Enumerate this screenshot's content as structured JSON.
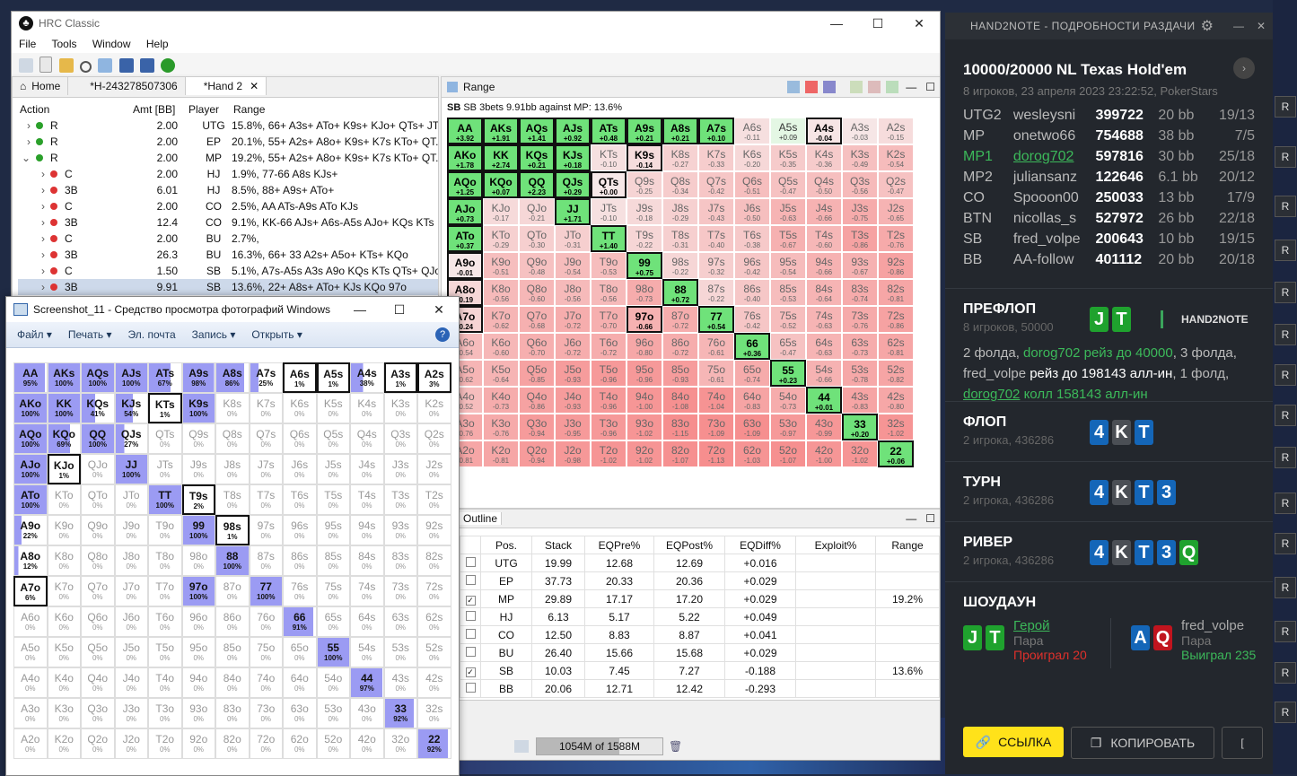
{
  "hrc": {
    "title": "HRC Classic",
    "menu": [
      "File",
      "Tools",
      "Window",
      "Help"
    ],
    "tabs": [
      {
        "label": "Home"
      },
      {
        "label": "*H-243278507306"
      },
      {
        "label": "*Hand 2"
      }
    ],
    "action_headers": [
      "Action",
      "Amt [BB]",
      "Player",
      "Range"
    ],
    "actions": [
      {
        "act": "R",
        "amt": "2.00",
        "player": "UTG",
        "range": "15.8%, 66+ A3s+ ATo+ K9s+ KJo+ QTs+ JTs",
        "color": "#2aa02a",
        "indent": 0
      },
      {
        "act": "R",
        "amt": "2.00",
        "player": "EP",
        "range": "20.1%, 55+ A2s+ A8o+ K9s+ K7s KTo+ QT...",
        "color": "#2aa02a",
        "indent": 0
      },
      {
        "act": "R",
        "amt": "2.00",
        "player": "MP",
        "range": "19.2%, 55+ A2s+ A8o+ K9s+ K7s KTo+ QT...",
        "color": "#2aa02a",
        "indent": 0
      },
      {
        "act": "C",
        "amt": "2.00",
        "player": "HJ",
        "range": "1.9%, 77-66 A8s KJs+",
        "color": "#d33",
        "indent": 1
      },
      {
        "act": "3B",
        "amt": "6.01",
        "player": "HJ",
        "range": "8.5%, 88+ A9s+ ATo+",
        "color": "#d33",
        "indent": 1
      },
      {
        "act": "C",
        "amt": "2.00",
        "player": "CO",
        "range": "2.5%, AA ATs-A9s ATo KJs",
        "color": "#d33",
        "indent": 1
      },
      {
        "act": "3B",
        "amt": "12.4",
        "player": "CO",
        "range": "9.1%, KK-66 AJs+ A6s-A5s AJo+ KQs KTs",
        "color": "#d33",
        "indent": 1
      },
      {
        "act": "C",
        "amt": "2.00",
        "player": "BU",
        "range": "2.7%,",
        "color": "#d33",
        "indent": 1
      },
      {
        "act": "3B",
        "amt": "26.3",
        "player": "BU",
        "range": "16.3%, 66+ 33 A2s+ A5o+ KTs+ KQo",
        "color": "#d33",
        "indent": 1
      },
      {
        "act": "C",
        "amt": "1.50",
        "player": "SB",
        "range": "5.1%, A7s-A5s A3s A9o KQs KTs QTs+ QJo...",
        "color": "#d33",
        "indent": 1
      },
      {
        "act": "3B",
        "amt": "9.91",
        "player": "SB",
        "range": "13.6%, 22+ A8s+ ATo+ KJs KQo 97o",
        "color": "#d33",
        "indent": 1
      }
    ],
    "range_tab": "Range",
    "range_title": "SB 3bets 9.91bb against MP: 13.6%",
    "outline_tab": "Outline",
    "outline_headers": [
      "Pos.",
      "Stack",
      "EQPre%",
      "EQPost%",
      "EQDiff%",
      "Exploit%",
      "Range"
    ],
    "outline_rows": [
      {
        "pos": "UTG",
        "stack": "19.99",
        "pre": "12.68",
        "post": "12.69",
        "diff": "+0.016",
        "exploit": "",
        "range": "",
        "checked": false
      },
      {
        "pos": "EP",
        "stack": "37.73",
        "pre": "20.33",
        "post": "20.36",
        "diff": "+0.029",
        "exploit": "",
        "range": "",
        "checked": false
      },
      {
        "pos": "MP",
        "stack": "29.89",
        "pre": "17.17",
        "post": "17.20",
        "diff": "+0.029",
        "exploit": "",
        "range": "19.2%",
        "checked": true
      },
      {
        "pos": "HJ",
        "stack": "6.13",
        "pre": "5.17",
        "post": "5.22",
        "diff": "+0.049",
        "exploit": "",
        "range": "",
        "checked": false
      },
      {
        "pos": "CO",
        "stack": "12.50",
        "pre": "8.83",
        "post": "8.87",
        "diff": "+0.041",
        "exploit": "",
        "range": "",
        "checked": false
      },
      {
        "pos": "BU",
        "stack": "26.40",
        "pre": "15.66",
        "post": "15.68",
        "diff": "+0.029",
        "exploit": "",
        "range": "",
        "checked": false
      },
      {
        "pos": "SB",
        "stack": "10.03",
        "pre": "7.45",
        "post": "7.27",
        "diff": "-0.188",
        "exploit": "",
        "range": "13.6%",
        "checked": true
      },
      {
        "pos": "BB",
        "stack": "20.06",
        "pre": "12.71",
        "post": "12.42",
        "diff": "-0.293",
        "exploit": "",
        "range": "",
        "checked": false
      }
    ],
    "memory": "1054M of 1588M",
    "memory_fraction": 0.66
  },
  "range_grid": {
    "hands": [
      [
        "AA",
        "AKs",
        "AQs",
        "AJs",
        "ATs",
        "A9s",
        "A8s",
        "A7s",
        "A6s",
        "A5s",
        "A4s",
        "A3s",
        "A2s"
      ],
      [
        "AKo",
        "KK",
        "KQs",
        "KJs",
        "KTs",
        "K9s",
        "K8s",
        "K7s",
        "K6s",
        "K5s",
        "K4s",
        "K3s",
        "K2s"
      ],
      [
        "AQo",
        "KQo",
        "QQ",
        "QJs",
        "QTs",
        "Q9s",
        "Q8s",
        "Q7s",
        "Q6s",
        "Q5s",
        "Q4s",
        "Q3s",
        "Q2s"
      ],
      [
        "AJo",
        "KJo",
        "QJo",
        "JJ",
        "JTs",
        "J9s",
        "J8s",
        "J7s",
        "J6s",
        "J5s",
        "J4s",
        "J3s",
        "J2s"
      ],
      [
        "ATo",
        "KTo",
        "QTo",
        "JTo",
        "TT",
        "T9s",
        "T8s",
        "T7s",
        "T6s",
        "T5s",
        "T4s",
        "T3s",
        "T2s"
      ],
      [
        "A9o",
        "K9o",
        "Q9o",
        "J9o",
        "T9o",
        "99",
        "98s",
        "97s",
        "96s",
        "95s",
        "94s",
        "93s",
        "92s"
      ],
      [
        "A8o",
        "K8o",
        "Q8o",
        "J8o",
        "T8o",
        "98o",
        "88",
        "87s",
        "86s",
        "85s",
        "84s",
        "83s",
        "82s"
      ],
      [
        "A7o",
        "K7o",
        "Q7o",
        "J7o",
        "T7o",
        "97o",
        "87o",
        "77",
        "76s",
        "75s",
        "74s",
        "73s",
        "72s"
      ],
      [
        "A6o",
        "K6o",
        "Q6o",
        "J6o",
        "T6o",
        "96o",
        "86o",
        "76o",
        "66",
        "65s",
        "64s",
        "63s",
        "62s"
      ],
      [
        "A5o",
        "K5o",
        "Q5o",
        "J5o",
        "T5o",
        "95o",
        "85o",
        "75o",
        "65o",
        "55",
        "54s",
        "53s",
        "52s"
      ],
      [
        "A4o",
        "K4o",
        "Q4o",
        "J4o",
        "T4o",
        "94o",
        "84o",
        "74o",
        "64o",
        "54o",
        "44",
        "43s",
        "42s"
      ],
      [
        "A3o",
        "K3o",
        "Q3o",
        "J3o",
        "T3o",
        "93o",
        "83o",
        "73o",
        "63o",
        "53o",
        "43o",
        "33",
        "32s"
      ],
      [
        "A2o",
        "K2o",
        "Q2o",
        "J2o",
        "T2o",
        "92o",
        "82o",
        "72o",
        "62o",
        "52o",
        "42o",
        "32o",
        "22"
      ]
    ],
    "values": [
      [
        "+3.92",
        "+1.91",
        "+1.41",
        "+0.92",
        "+0.48",
        "+0.21",
        "+0.21",
        "+0.10",
        "-0.11",
        "+0.09",
        "-0.04",
        "-0.03",
        "-0.15"
      ],
      [
        "+1.78",
        "+2.74",
        "+0.21",
        "+0.18",
        "-0.10",
        "-0.14",
        "-0.27",
        "-0.33",
        "-0.20",
        "-0.35",
        "-0.36",
        "-0.49",
        "-0.54"
      ],
      [
        "+1.25",
        "+0.07",
        "+2.23",
        "+0.29",
        "+0.00",
        "-0.25",
        "-0.34",
        "-0.42",
        "-0.51",
        "-0.47",
        "-0.50",
        "-0.56",
        "-0.47"
      ],
      [
        "+0.73",
        "-0.17",
        "-0.21",
        "+1.71",
        "-0.10",
        "-0.18",
        "-0.29",
        "-0.43",
        "-0.50",
        "-0.63",
        "-0.66",
        "-0.75",
        "-0.65"
      ],
      [
        "+0.37",
        "-0.29",
        "-0.30",
        "-0.31",
        "+1.40",
        "-0.22",
        "-0.31",
        "-0.40",
        "-0.38",
        "-0.67",
        "-0.60",
        "-0.86",
        "-0.76"
      ],
      [
        "-0.01",
        "-0.51",
        "-0.48",
        "-0.54",
        "-0.53",
        "+0.75",
        "-0.22",
        "-0.32",
        "-0.42",
        "-0.54",
        "-0.66",
        "-0.67",
        "-0.86"
      ],
      [
        "-0.19",
        "-0.56",
        "-0.60",
        "-0.56",
        "-0.56",
        "-0.73",
        "+0.72",
        "-0.22",
        "-0.40",
        "-0.53",
        "-0.64",
        "-0.74",
        "-0.81"
      ],
      [
        "-0.24",
        "-0.62",
        "-0.68",
        "-0.72",
        "-0.70",
        "-0.66",
        "-0.72",
        "+0.54",
        "-0.42",
        "-0.52",
        "-0.63",
        "-0.76",
        "-0.86"
      ],
      [
        "-0.54",
        "-0.60",
        "-0.70",
        "-0.72",
        "-0.72",
        "-0.80",
        "-0.72",
        "-0.61",
        "+0.36",
        "-0.47",
        "-0.63",
        "-0.73",
        "-0.81"
      ],
      [
        "-0.62",
        "-0.64",
        "-0.85",
        "-0.93",
        "-0.96",
        "-0.96",
        "-0.93",
        "-0.61",
        "-0.74",
        "+0.23",
        "-0.66",
        "-0.78",
        "-0.82"
      ],
      [
        "-0.52",
        "-0.73",
        "-0.86",
        "-0.93",
        "-0.96",
        "-1.00",
        "-1.08",
        "-1.04",
        "-0.83",
        "-0.73",
        "+0.01",
        "-0.83",
        "-0.80"
      ],
      [
        "-0.76",
        "-0.76",
        "-0.94",
        "-0.95",
        "-0.96",
        "-1.02",
        "-1.15",
        "-1.09",
        "-1.09",
        "-0.97",
        "-0.99",
        "+0.20",
        "-1.02"
      ],
      [
        "-0.81",
        "-0.81",
        "-0.94",
        "-0.98",
        "-1.02",
        "-1.02",
        "-1.07",
        "-1.13",
        "-1.03",
        "-1.07",
        "-1.00",
        "-1.02",
        "+0.06"
      ]
    ],
    "selected": [
      [
        1,
        1,
        1,
        1,
        1,
        1,
        1,
        1,
        0,
        0,
        1,
        0,
        0
      ],
      [
        1,
        1,
        1,
        1,
        0,
        1,
        0,
        0,
        0,
        0,
        0,
        0,
        0
      ],
      [
        1,
        1,
        1,
        1,
        1,
        0,
        0,
        0,
        0,
        0,
        0,
        0,
        0
      ],
      [
        1,
        0,
        0,
        1,
        0,
        0,
        0,
        0,
        0,
        0,
        0,
        0,
        0
      ],
      [
        1,
        0,
        0,
        0,
        1,
        0,
        0,
        0,
        0,
        0,
        0,
        0,
        0
      ],
      [
        1,
        0,
        0,
        0,
        0,
        1,
        0,
        0,
        0,
        0,
        0,
        0,
        0
      ],
      [
        1,
        0,
        0,
        0,
        0,
        0,
        1,
        0,
        0,
        0,
        0,
        0,
        0
      ],
      [
        1,
        0,
        0,
        0,
        0,
        1,
        0,
        1,
        0,
        0,
        0,
        0,
        0
      ],
      [
        0,
        0,
        0,
        0,
        0,
        0,
        0,
        0,
        1,
        0,
        0,
        0,
        0
      ],
      [
        0,
        0,
        0,
        0,
        0,
        0,
        0,
        0,
        0,
        1,
        0,
        0,
        0
      ],
      [
        0,
        0,
        0,
        0,
        0,
        0,
        0,
        0,
        0,
        0,
        1,
        0,
        0
      ],
      [
        0,
        0,
        0,
        0,
        0,
        0,
        0,
        0,
        0,
        0,
        0,
        1,
        0
      ],
      [
        0,
        0,
        0,
        0,
        0,
        0,
        0,
        0,
        0,
        0,
        0,
        0,
        1
      ]
    ]
  },
  "viewer": {
    "title": "Screenshot_11 - Средство просмотра фотографий Windows",
    "menu": [
      "Файл",
      "Печать",
      "Эл. почта",
      "Запись",
      "Открыть"
    ],
    "percents": [
      [
        "95%",
        "100%",
        "100%",
        "100%",
        "67%",
        "98%",
        "86%",
        "25%",
        "1%",
        "1%",
        "38%",
        "1%",
        "3%"
      ],
      [
        "100%",
        "100%",
        "41%",
        "54%",
        "1%",
        "100%",
        "0%",
        "0%",
        "0%",
        "0%",
        "0%",
        "0%",
        "0%"
      ],
      [
        "100%",
        "69%",
        "100%",
        "27%",
        "0%",
        "0%",
        "0%",
        "0%",
        "0%",
        "0%",
        "0%",
        "0%",
        "0%"
      ],
      [
        "100%",
        "1%",
        "0%",
        "100%",
        "0%",
        "0%",
        "0%",
        "0%",
        "0%",
        "0%",
        "0%",
        "0%",
        "0%"
      ],
      [
        "100%",
        "0%",
        "0%",
        "0%",
        "100%",
        "2%",
        "0%",
        "0%",
        "0%",
        "0%",
        "0%",
        "0%",
        "0%"
      ],
      [
        "22%",
        "0%",
        "0%",
        "0%",
        "0%",
        "100%",
        "1%",
        "0%",
        "0%",
        "0%",
        "0%",
        "0%",
        "0%"
      ],
      [
        "12%",
        "0%",
        "0%",
        "0%",
        "0%",
        "0%",
        "100%",
        "0%",
        "0%",
        "0%",
        "0%",
        "0%",
        "0%"
      ],
      [
        "6%",
        "0%",
        "0%",
        "0%",
        "0%",
        "100%",
        "0%",
        "100%",
        "0%",
        "0%",
        "0%",
        "0%",
        "0%"
      ],
      [
        "0%",
        "0%",
        "0%",
        "0%",
        "0%",
        "0%",
        "0%",
        "0%",
        "91%",
        "0%",
        "0%",
        "0%",
        "0%"
      ],
      [
        "0%",
        "0%",
        "0%",
        "0%",
        "0%",
        "0%",
        "0%",
        "0%",
        "0%",
        "100%",
        "0%",
        "0%",
        "0%"
      ],
      [
        "0%",
        "0%",
        "0%",
        "0%",
        "0%",
        "0%",
        "0%",
        "0%",
        "0%",
        "0%",
        "97%",
        "0%",
        "0%"
      ],
      [
        "0%",
        "0%",
        "0%",
        "0%",
        "0%",
        "0%",
        "0%",
        "0%",
        "0%",
        "0%",
        "0%",
        "92%",
        "0%"
      ],
      [
        "0%",
        "0%",
        "0%",
        "0%",
        "0%",
        "0%",
        "0%",
        "0%",
        "0%",
        "0%",
        "0%",
        "0%",
        "92%"
      ]
    ],
    "fill": [
      [
        0.95,
        1,
        1,
        1,
        0.67,
        0.98,
        0.86,
        0.25,
        0,
        0,
        0.38,
        0,
        0
      ],
      [
        1,
        1,
        0.41,
        0.54,
        0,
        1,
        0,
        0,
        0,
        0,
        0,
        0,
        0
      ],
      [
        1,
        0.69,
        1,
        0.27,
        0,
        0,
        0,
        0,
        0,
        0,
        0,
        0,
        0
      ],
      [
        1,
        0,
        0,
        1,
        0,
        0,
        0,
        0,
        0,
        0,
        0,
        0,
        0
      ],
      [
        1,
        0,
        0,
        0,
        1,
        0,
        0,
        0,
        0,
        0,
        0,
        0,
        0
      ],
      [
        0.22,
        0,
        0,
        0,
        0,
        1,
        0,
        0,
        0,
        0,
        0,
        0,
        0
      ],
      [
        0.12,
        0,
        0,
        0,
        0,
        0,
        1,
        0,
        0,
        0,
        0,
        0,
        0
      ],
      [
        0.06,
        0,
        0,
        0,
        0,
        1,
        0,
        1,
        0,
        0,
        0,
        0,
        0
      ],
      [
        0,
        0,
        0,
        0,
        0,
        0,
        0,
        0,
        0.91,
        0,
        0,
        0,
        0
      ],
      [
        0,
        0,
        0,
        0,
        0,
        0,
        0,
        0,
        0,
        1,
        0,
        0,
        0
      ],
      [
        0,
        0,
        0,
        0,
        0,
        0,
        0,
        0,
        0,
        0,
        0.97,
        0,
        0
      ],
      [
        0,
        0,
        0,
        0,
        0,
        0,
        0,
        0,
        0,
        0,
        0,
        0.92,
        0
      ],
      [
        0,
        0,
        0,
        0,
        0,
        0,
        0,
        0,
        0,
        0,
        0,
        0,
        0.92
      ]
    ]
  },
  "h2n": {
    "title": "HAND2NOTE - ПОДРОБНОСТИ РАЗДАЧИ",
    "game": "10000/20000 NL Texas Hold'em",
    "info": "8 игроков, 23 апреля 2023 23:22:52, PokerStars",
    "players": [
      {
        "pos": "UTG2",
        "name": "wesleysni",
        "chips": "399722",
        "bb": "20 bb",
        "stat": "19/13",
        "hero": false
      },
      {
        "pos": "MP",
        "name": "onetwo66",
        "chips": "754688",
        "bb": "38 bb",
        "stat": "7/5",
        "hero": false
      },
      {
        "pos": "MP1",
        "name": "dorog702",
        "chips": "597816",
        "bb": "30 bb",
        "stat": "25/18",
        "hero": true
      },
      {
        "pos": "MP2",
        "name": "juliansanz",
        "chips": "122646",
        "bb": "6.1 bb",
        "stat": "20/12",
        "hero": false
      },
      {
        "pos": "CO",
        "name": "Spooon00",
        "chips": "250033",
        "bb": "13 bb",
        "stat": "17/9",
        "hero": false
      },
      {
        "pos": "BTN",
        "name": "nicollas_s",
        "chips": "527972",
        "bb": "26 bb",
        "stat": "22/18",
        "hero": false
      },
      {
        "pos": "SB",
        "name": "fred_volpe",
        "chips": "200643",
        "bb": "10 bb",
        "stat": "19/15",
        "hero": false
      },
      {
        "pos": "BB",
        "name": "AA-follow",
        "chips": "401112",
        "bb": "20 bb",
        "stat": "20/18",
        "hero": false
      }
    ],
    "preflop": {
      "label": "ПРЕФЛОП",
      "sub": "8 игроков, 50000",
      "logo": "HAND2NOTE",
      "t1": "2 фолда, ",
      "hero1": "dorog702 рейз до 40000",
      "t2": ", 3 фолда, fred_volpe ",
      "b1": "рейз до 198143 алл-ин",
      "t3": ", 1 фолд, ",
      "hero2": "dorog702",
      "hero3": " колл 158143 алл-ин"
    },
    "flop": {
      "label": "ФЛОП",
      "sub": "2 игрока, 436286"
    },
    "turn": {
      "label": "ТУРН",
      "sub": "2 игрока, 436286"
    },
    "river": {
      "label": "РИВЕР",
      "sub": "2 игрока, 436286"
    },
    "showdown": {
      "label": "ШОУДАУН",
      "hero_name": "Герой",
      "hero_hand": "Пара",
      "hero_result": "Проиграл 20",
      "opp_name": "fred_volpe",
      "opp_hand": "Пара",
      "opp_result": "Выиграл 235"
    },
    "link_button": "ССЫЛКА",
    "copy_button": "КОПИРОВАТЬ",
    "side_label": "R"
  }
}
